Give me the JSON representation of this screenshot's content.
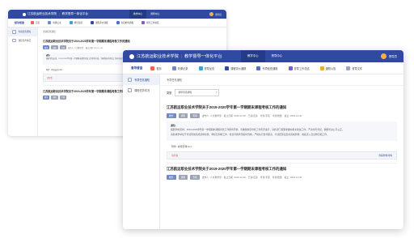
{
  "app": {
    "logo": "江苏航运职业技术学院",
    "system": "教学督导一体化平台"
  },
  "header_nav": [
    "教学中心",
    "督导中心"
  ],
  "user": "督导员",
  "toolbar": {
    "title": "督导督查",
    "items": [
      {
        "label": "首页",
        "icon": "home-icon",
        "color": "#e06a4f"
      },
      {
        "label": "听课记录",
        "icon": "record-icon",
        "color": "#6f89c9"
      },
      {
        "label": "督导反馈",
        "icon": "feedback-icon",
        "color": "#3aa2d8"
      },
      {
        "label": "课程评价通报",
        "icon": "report-icon",
        "color": "#2f4aa0"
      },
      {
        "label": "专项检查通报",
        "icon": "check-icon",
        "color": "#4b6fd1"
      },
      {
        "label": "督导工作总结",
        "icon": "summary-icon",
        "color": "#7c5cd6"
      },
      {
        "label": "通知公告",
        "icon": "bell-icon",
        "color": "#f1a93a"
      },
      {
        "label": "督导文件",
        "icon": "file-icon",
        "color": "#9aa6c2"
      }
    ]
  },
  "sidebar": {
    "items": [
      {
        "label": "专项任务通知",
        "active": true
      },
      {
        "label": "课程任务情况",
        "active": false
      }
    ]
  },
  "breadcrumb": "专项任务通知",
  "filter": {
    "label": "类型",
    "value": "督导专项通知"
  },
  "notices": [
    {
      "title": "江苏航运职业技术学院关于2019-2020学年第一学期期末课程考核工作的通知",
      "tags": [
        "教务",
        "通知",
        "专项"
      ],
      "meta": [
        "发布人: 人文教学部",
        "截止日期: 2019-12-30",
        "已读/应读",
        "考核/专项",
        "考核/数量",
        "截止: 2019-12-30"
      ],
      "body_title": "通知:",
      "paragraphs": [
        "根据学校安排，2019-2020学年第一学期期末课程考核工作即将开始，为确保各项考核工作有序进行，请各部门按要求做好相关准备工作，严肃考风考纪，确保考试公平公正。",
        "请各教学单位于考试周前完成试卷命题、审核及印制工作，各监考教师须按时到岗，严格执行监考职责，考试结束后及时完成阅卷、成绩录入及试卷归档工作。"
      ],
      "attachment": "附件: 考核安排.doc",
      "message_left": "请查看",
      "message_right": "查看附件详情"
    },
    {
      "title": "江苏航运职业技术学院关于2019-2020学年第一学期期末课程考核工作的通知",
      "tags": [
        "教务",
        "通知",
        "专项"
      ],
      "meta": [
        "发布人: 人文教学部",
        "截止日期: 2019-12-30",
        "已读/应读",
        "考核/专项",
        "考核/数量",
        "截止: 2019-12-30"
      ]
    }
  ]
}
